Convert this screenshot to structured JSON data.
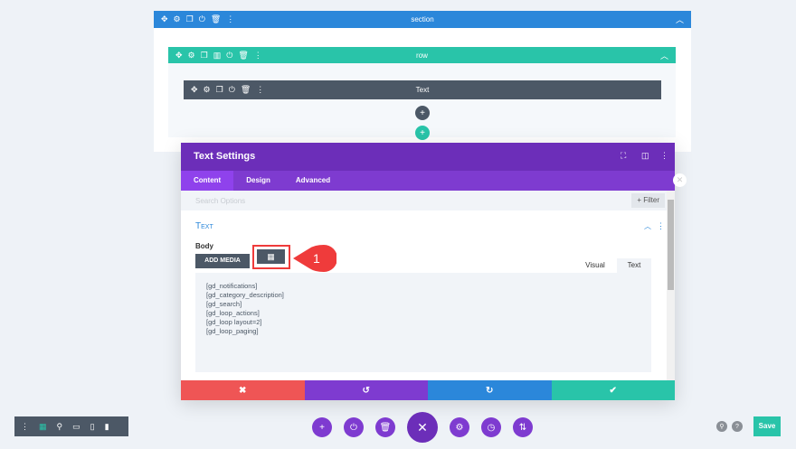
{
  "section": {
    "title": "section",
    "color": "#2b87da"
  },
  "row": {
    "title": "row",
    "color": "#29c4a9"
  },
  "module": {
    "title": "Text",
    "color": "#4c5866"
  },
  "modal": {
    "title": "Text Settings",
    "tabs": [
      "Content",
      "Design",
      "Advanced"
    ],
    "search_placeholder": "Search Options",
    "filter_label": "+ Filter",
    "group_title": "Text",
    "body_label": "Body",
    "add_media_label": "ADD MEDIA",
    "editor_tabs": [
      "Visual",
      "Text"
    ],
    "content_lines": [
      "[gd_notifications]",
      "[gd_category_description]",
      "[gd_search]",
      "[gd_loop_actions]",
      "[gd_loop layout=2]",
      "[gd_loop_paging]"
    ],
    "callout_number": "1"
  },
  "footer": {
    "cancel": "✖",
    "undo": "↺",
    "redo": "↻",
    "confirm": "✔"
  },
  "save_label": "Save"
}
